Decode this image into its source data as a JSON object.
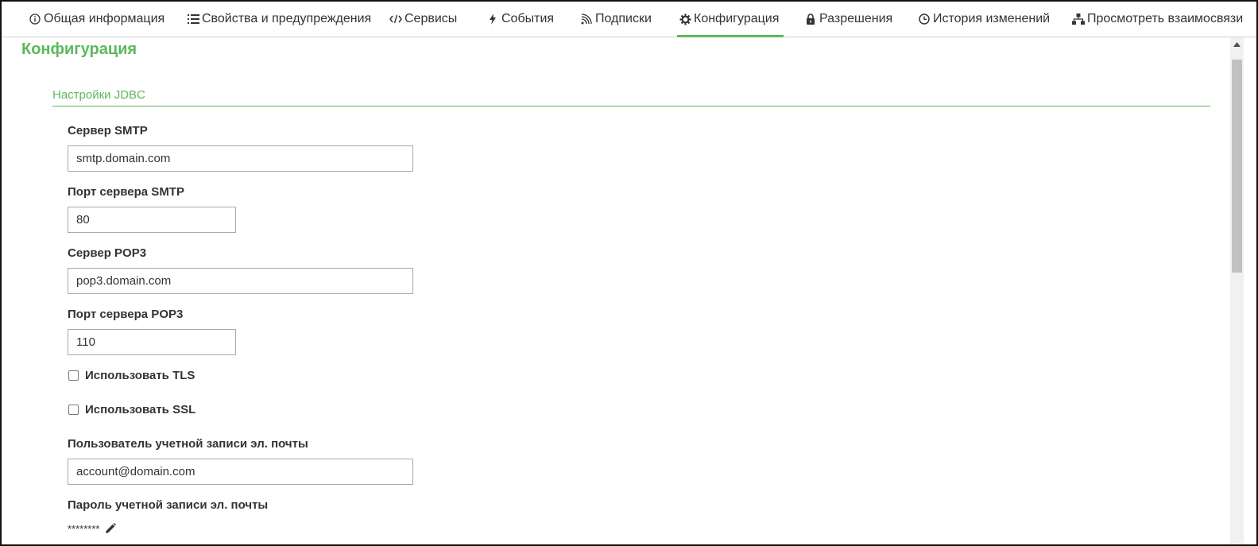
{
  "tabs": [
    {
      "label": "Общая информация",
      "icon": "info-icon"
    },
    {
      "label": "Свойства и предупреждения",
      "icon": "list-icon"
    },
    {
      "label": "Сервисы",
      "icon": "code-icon"
    },
    {
      "label": "События",
      "icon": "bolt-icon"
    },
    {
      "label": "Подписки",
      "icon": "rss-icon"
    },
    {
      "label": "Конфигурация",
      "icon": "gear-icon",
      "active": true
    },
    {
      "label": "Разрешения",
      "icon": "lock-icon"
    },
    {
      "label": "История изменений",
      "icon": "clock-icon"
    },
    {
      "label": "Просмотреть взаимосвязи",
      "icon": "sitemap-icon"
    }
  ],
  "page": {
    "title": "Конфигурация"
  },
  "section": {
    "title": "Настройки JDBC"
  },
  "fields": {
    "smtp_server": {
      "label": "Сервер SMTP",
      "value": "smtp.domain.com"
    },
    "smtp_port": {
      "label": "Порт сервера SMTP",
      "value": "80"
    },
    "pop3_server": {
      "label": "Сервер POP3",
      "value": "pop3.domain.com"
    },
    "pop3_port": {
      "label": "Порт сервера POP3",
      "value": "110"
    },
    "use_tls": {
      "label": "Использовать TLS",
      "checked": false
    },
    "use_ssl": {
      "label": "Использовать SSL",
      "checked": false
    },
    "account_user": {
      "label": "Пользователь учетной записи эл. почты",
      "value": "account@domain.com"
    },
    "account_password": {
      "label": "Пароль учетной записи эл. почты",
      "value": "********"
    }
  },
  "colors": {
    "accent": "#5cb85c",
    "text": "#333333",
    "border": "#a9a9a9"
  }
}
